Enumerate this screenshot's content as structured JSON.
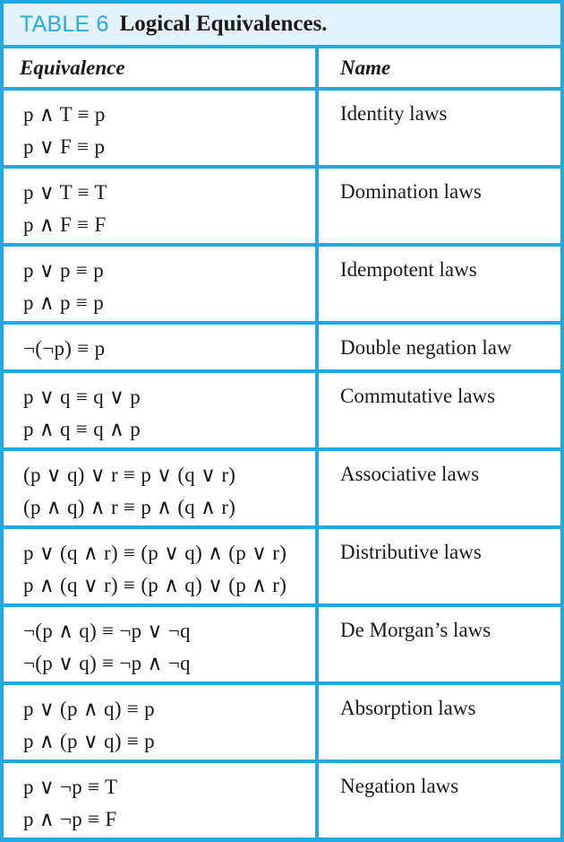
{
  "caption": {
    "label": "TABLE 6",
    "title": "Logical Equivalences.",
    "label_color": "#29abe2",
    "background": "#e3f2fc"
  },
  "theme": {
    "rule_color": "#21a9e1",
    "text_color": "#1a1a1a",
    "page_background": "#ffffff"
  },
  "columns": {
    "equivalence_header": "Equivalence",
    "name_header": "Name"
  },
  "rows": [
    {
      "name": "Identity laws",
      "formulas": [
        "p ∧ T ≡ p",
        "p ∨ F ≡ p"
      ]
    },
    {
      "name": "Domination laws",
      "formulas": [
        "p ∨ T ≡ T",
        "p ∧ F ≡ F"
      ]
    },
    {
      "name": "Idempotent laws",
      "formulas": [
        "p ∨ p ≡ p",
        "p ∧ p ≡ p"
      ]
    },
    {
      "name": "Double negation law",
      "formulas": [
        "¬(¬p) ≡ p"
      ]
    },
    {
      "name": "Commutative laws",
      "formulas": [
        "p ∨ q ≡ q ∨ p",
        "p ∧ q ≡ q ∧ p"
      ]
    },
    {
      "name": "Associative laws",
      "formulas": [
        "(p ∨ q) ∨ r ≡ p ∨ (q ∨ r)",
        "(p ∧ q) ∧ r ≡ p ∧ (q ∧ r)"
      ]
    },
    {
      "name": "Distributive laws",
      "formulas": [
        "p ∨ (q ∧ r) ≡ (p ∨ q) ∧ (p ∨ r)",
        "p ∧ (q ∨ r) ≡ (p ∧ q) ∨ (p ∧ r)"
      ]
    },
    {
      "name": "De Morgan’s laws",
      "formulas": [
        "¬(p ∧ q) ≡ ¬p ∨ ¬q",
        "¬(p ∨ q) ≡ ¬p ∧ ¬q"
      ]
    },
    {
      "name": "Absorption laws",
      "formulas": [
        "p ∨ (p ∧ q) ≡ p",
        "p ∧ (p ∨ q) ≡ p"
      ]
    },
    {
      "name": "Negation laws",
      "formulas": [
        "p ∨ ¬p ≡ T",
        "p ∧ ¬p ≡ F"
      ]
    }
  ]
}
